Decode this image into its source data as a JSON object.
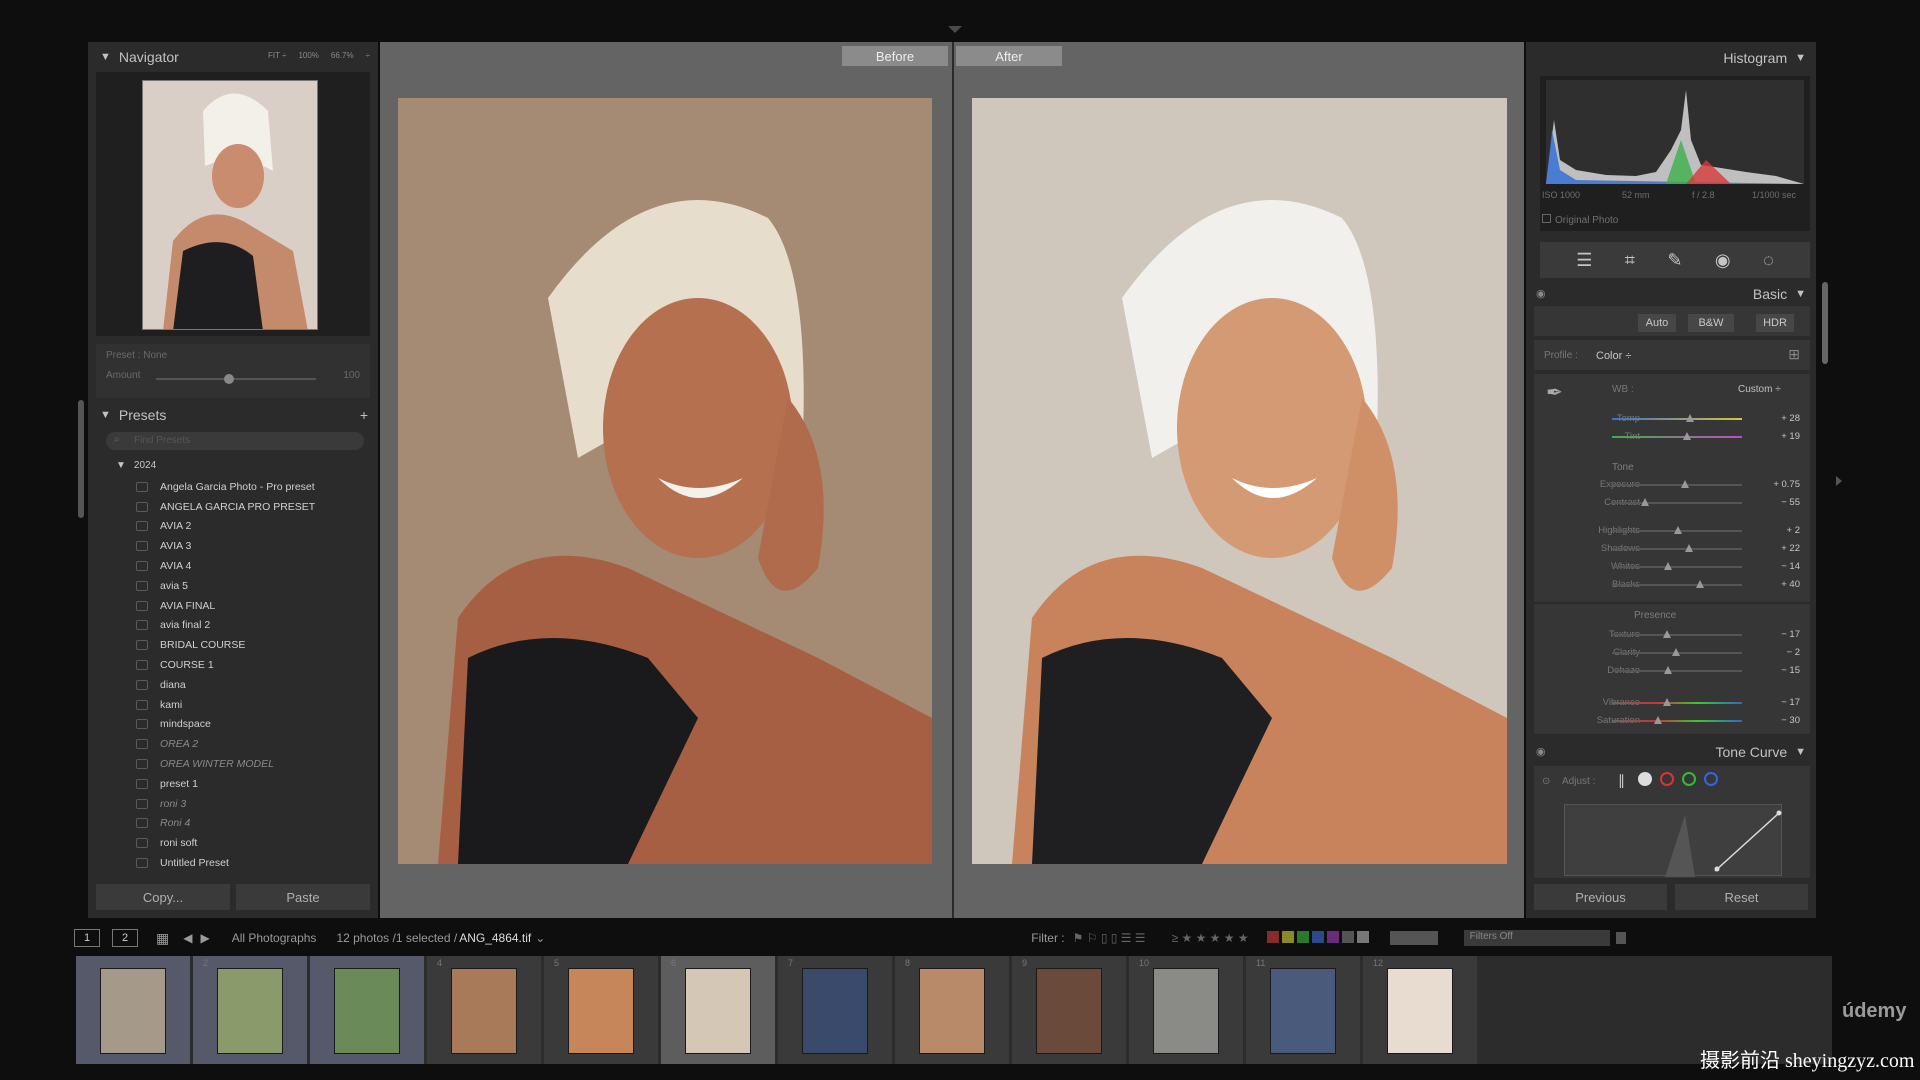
{
  "navigator": {
    "title": "Navigator",
    "zoom_options": [
      "FIT ÷",
      "100%",
      "66.7%",
      "÷"
    ]
  },
  "preset_amount": {
    "preset_label": "Preset : None",
    "amount_label": "Amount",
    "amount_value": "100"
  },
  "presets": {
    "title": "Presets",
    "add_symbol": "+",
    "search_placeholder": "Find Presets",
    "folder": "2024",
    "items": [
      {
        "label": "Angela Garcia Photo - Pro preset",
        "dim": false
      },
      {
        "label": "ANGELA GARCIA PRO PRESET",
        "dim": false
      },
      {
        "label": "AVIA 2",
        "dim": false
      },
      {
        "label": "AVIA 3",
        "dim": false
      },
      {
        "label": "AVIA 4",
        "dim": false
      },
      {
        "label": "avia 5",
        "dim": false
      },
      {
        "label": "AVIA FINAL",
        "dim": false
      },
      {
        "label": "avia final 2",
        "dim": false
      },
      {
        "label": "BRIDAL COURSE",
        "dim": false
      },
      {
        "label": "COURSE 1",
        "dim": false
      },
      {
        "label": "diana",
        "dim": false
      },
      {
        "label": "kami",
        "dim": false
      },
      {
        "label": "mindspace",
        "dim": false
      },
      {
        "label": "OREA 2",
        "dim": true
      },
      {
        "label": "OREA WINTER MODEL",
        "dim": true
      },
      {
        "label": "preset 1",
        "dim": false
      },
      {
        "label": "roni 3",
        "dim": true
      },
      {
        "label": "Roni 4",
        "dim": true
      },
      {
        "label": "roni soft",
        "dim": false
      },
      {
        "label": "Untitled Preset",
        "dim": false
      }
    ]
  },
  "left_buttons": {
    "copy": "Copy...",
    "paste": "Paste"
  },
  "compare": {
    "before": "Before",
    "after": "After"
  },
  "histogram": {
    "title": "Histogram",
    "iso": "ISO 1000",
    "focal": "52 mm",
    "aperture": "f / 2.8",
    "shutter": "1/1000 sec",
    "original_photo": "Original Photo"
  },
  "basic": {
    "title": "Basic",
    "auto": "Auto",
    "bw": "B&W",
    "hdr": "HDR",
    "profile_label": "Profile :",
    "profile_value": "Color ÷",
    "wb_label": "WB :",
    "wb_value": "Custom ÷",
    "tone_title": "Tone",
    "presence_title": "Presence",
    "sliders": [
      {
        "label": "Temp",
        "value": "+ 28",
        "pos": 0.6
      },
      {
        "label": "Tint",
        "value": "+ 19",
        "pos": 0.58
      },
      {
        "label": "Exposure",
        "value": "+ 0.75",
        "pos": 0.56
      },
      {
        "label": "Contrast",
        "value": "− 55",
        "pos": 0.25
      },
      {
        "label": "Highlights",
        "value": "+ 2",
        "pos": 0.51
      },
      {
        "label": "Shadows",
        "value": "+ 22",
        "pos": 0.59
      },
      {
        "label": "Whites",
        "value": "− 14",
        "pos": 0.43
      },
      {
        "label": "Blacks",
        "value": "+ 40",
        "pos": 0.68
      },
      {
        "label": "Texture",
        "value": "− 17",
        "pos": 0.42
      },
      {
        "label": "Clarity",
        "value": "− 2",
        "pos": 0.49
      },
      {
        "label": "Dehaze",
        "value": "− 15",
        "pos": 0.43
      },
      {
        "label": "Vibrance",
        "value": "− 17",
        "pos": 0.42
      },
      {
        "label": "Saturation",
        "value": "− 30",
        "pos": 0.35
      }
    ]
  },
  "tone_curve": {
    "title": "Tone Curve",
    "adjust_label": "Adjust :"
  },
  "right_buttons": {
    "previous": "Previous",
    "reset": "Reset"
  },
  "film_bar": {
    "view1": "1",
    "view2": "2",
    "source": "All Photographs",
    "count": "12 photos /1 selected /",
    "filename": "ANG_4864.tif",
    "filter_label": "Filter :",
    "filters_off": "Filters Off",
    "stars": "≥ ★ ★ ★ ★ ★"
  },
  "filmstrip": {
    "cells": [
      "",
      "2",
      "",
      "4",
      "5",
      "6",
      "7",
      "8",
      "9",
      "10",
      "11",
      "12"
    ]
  },
  "brand": "údemy",
  "watermark": "摄影前沿 sheyingzyz.com",
  "colors": {
    "accent": "#2c2c2d",
    "label_swatches": [
      "#8a2b2b",
      "#8a8a2b",
      "#2b7a2b",
      "#2b4a8a",
      "#6a2b7a",
      "#555555",
      "#777777"
    ]
  }
}
